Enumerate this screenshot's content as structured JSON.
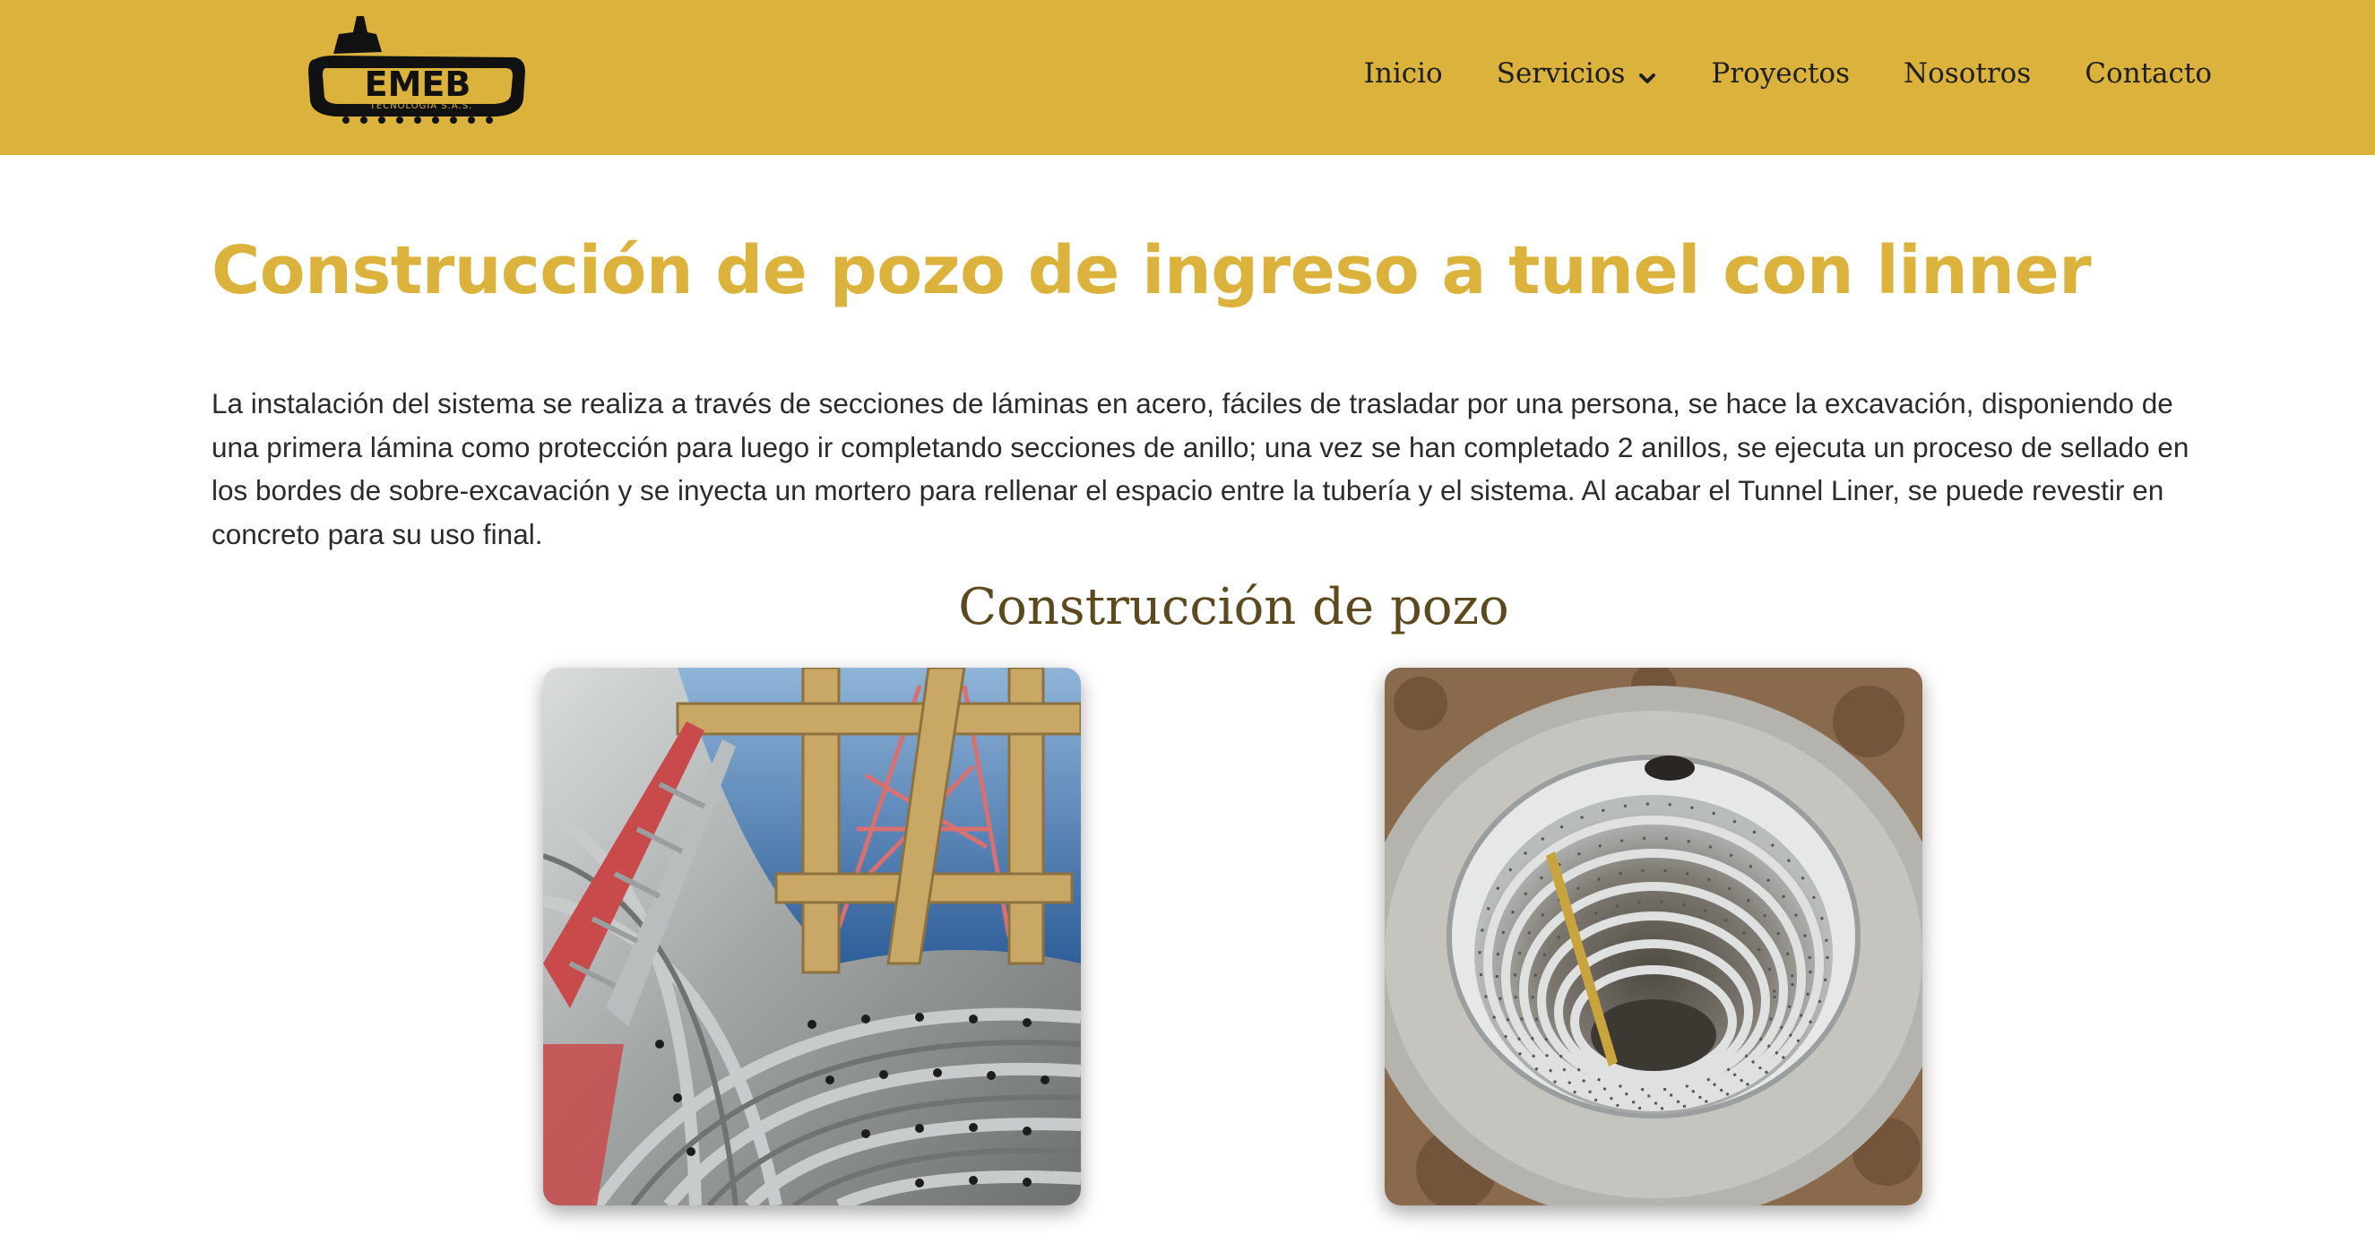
{
  "header": {
    "logo": {
      "name": "EMEB",
      "subtitle": "TECNOLOGÍA S.A.S."
    },
    "nav": [
      {
        "label": "Inicio"
      },
      {
        "label": "Servicios",
        "has_dropdown": true,
        "icon": "chevron-down-icon"
      },
      {
        "label": "Proyectos"
      },
      {
        "label": "Nosotros"
      },
      {
        "label": "Contacto"
      }
    ]
  },
  "main": {
    "title": "Construcción de pozo de ingreso a tunel con linner",
    "intro": "La instalación del sistema se realiza a través de secciones de láminas en acero, fáciles de trasladar por una persona, se hace la excavación, disponiendo de una primera lámina como protección para luego ir completando secciones de anillo; una vez se han completado 2 anillos, se ejecuta un proceso de sellado en los bordes de sobre-excavación y se inyecta un mortero para rellenar el espacio entre la tubería y el sistema. Al acabar el Tunnel Liner, se puede revestir en concreto para su uso final.",
    "section_title": "Construcción de pozo"
  },
  "colors": {
    "brand_yellow": "#dbb33c",
    "section_title_brown": "#5c4a1e",
    "body_text": "#2b2b2b"
  }
}
